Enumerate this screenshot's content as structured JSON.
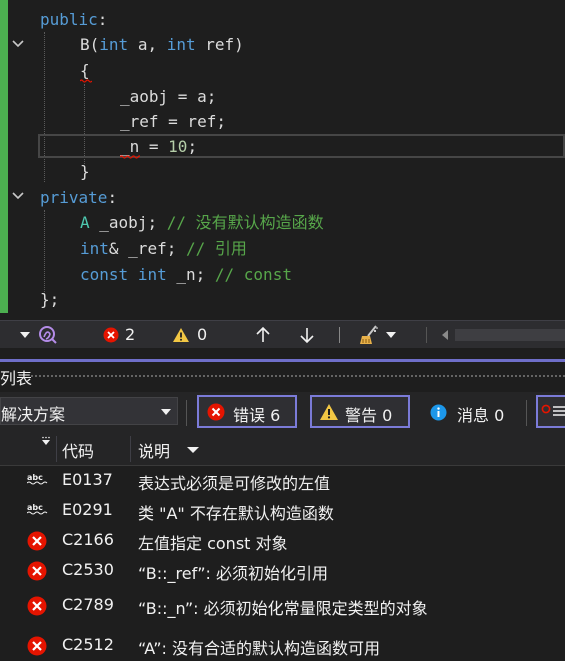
{
  "editor": {
    "lines": {
      "l1": {
        "kw": "public",
        "rest": ":"
      },
      "l2": {
        "fn": "B",
        "p1": "(",
        "t1": "int",
        "a": " a, ",
        "t2": "int",
        "r": " ref)"
      },
      "l3": {
        "text": "{"
      },
      "l4": {
        "text": "_aobj = a;"
      },
      "l5": {
        "text": "_ref = ref;"
      },
      "l6": {
        "id": "_n",
        "eq": " = ",
        "num": "10",
        "semi": ";"
      },
      "l7": {
        "text": "}"
      },
      "l8": {
        "kw": "private",
        "rest": ":"
      },
      "l9": {
        "ty": "A",
        "id": " _aobj; ",
        "cm": "// 没有默认构造函数"
      },
      "l10": {
        "kw": "int",
        "id": "& _ref; ",
        "cm": "// 引用"
      },
      "l11": {
        "kw1": "const",
        "kw2": "int",
        "id": " _n; ",
        "cm": "// const"
      },
      "l12": {
        "text": "};"
      }
    }
  },
  "status": {
    "errors": "2",
    "warnings": "0"
  },
  "panel": {
    "title": "列表",
    "scope": "解决方案",
    "filters": {
      "errors": "错误 6",
      "warnings": "警告 0",
      "messages": "消息 0"
    },
    "headers": {
      "code": "代码",
      "description": "说明"
    },
    "rows": [
      {
        "type": "abc",
        "code": "E0137",
        "desc": "表达式必须是可修改的左值"
      },
      {
        "type": "abc",
        "code": "E0291",
        "desc": "类 \"A\" 不存在默认构造函数"
      },
      {
        "type": "error",
        "code": "C2166",
        "desc": "左值指定 const 对象"
      },
      {
        "type": "error",
        "code": "C2530",
        "desc": "“B::_ref”: 必须初始化引用"
      },
      {
        "type": "error",
        "code": "C2789",
        "desc": "“B::_n”: 必须初始化常量限定类型的对象"
      },
      {
        "type": "error",
        "code": "C2512",
        "desc": "“A”: 没有合适的默认构造函数可用"
      }
    ]
  },
  "colors": {
    "accent": "#7b7bd8",
    "error": "#e51400",
    "warning": "#f2c744",
    "info": "#1c97ea",
    "change": "#4caf50"
  }
}
